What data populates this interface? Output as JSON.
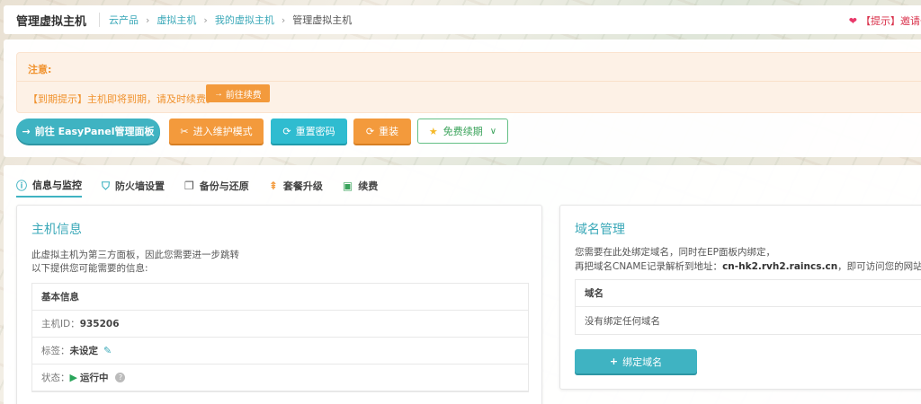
{
  "breadcrumb": {
    "title": "管理虚拟主机",
    "items": [
      "云产品",
      "虚拟主机",
      "我的虚拟主机",
      "管理虚拟主机"
    ],
    "tip": "【提示】邀请一"
  },
  "notice": {
    "title": "注意:",
    "text": "【到期提示】主机即将到期，请及时续费。",
    "renew_button": "前往续费"
  },
  "actions": {
    "easypanel": "前往 EasyPanel管理面板",
    "maintenance": "进入维护模式",
    "reset_password": "重置密码",
    "reinstall": "重装",
    "free_renew": "免费续期"
  },
  "tabs": [
    "信息与监控",
    "防火墙设置",
    "备份与还原",
    "套餐升级",
    "续费"
  ],
  "host_info": {
    "title": "主机信息",
    "desc_line1": "此虚拟主机为第三方面板，因此您需要进一步跳转",
    "desc_line2": "以下提供您可能需要的信息:",
    "table_header": "基本信息",
    "id_label": "主机ID：",
    "id_value": "935206",
    "tag_label": "标签：",
    "tag_value": "未设定",
    "status_label": "状态：",
    "status_value": "运行中"
  },
  "domain": {
    "title": "域名管理",
    "desc_line1": "您需要在此处绑定域名，同时在EP面板内绑定，",
    "desc_line2_prefix": "再把域名CNAME记录解析到地址：",
    "cname": "cn-hk2.rvh2.raincs.cn",
    "desc_line2_suffix": "，即可访问您的网站",
    "table_header": "域名",
    "empty_text": "没有绑定任何域名",
    "bind_button": "绑定域名"
  },
  "colors": {
    "accent": "#3fb3c2",
    "orange": "#f39a3c",
    "green": "#39a35b"
  }
}
